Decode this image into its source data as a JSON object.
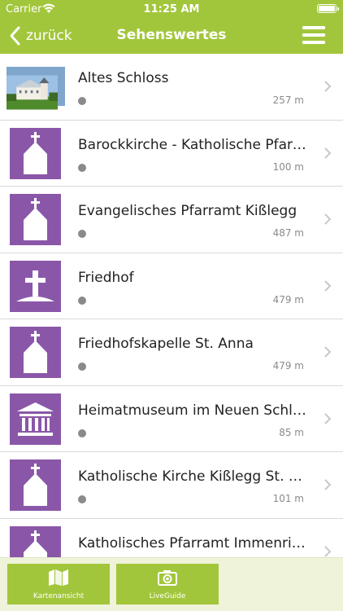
{
  "status": {
    "carrier": "Carrier",
    "time": "11:25 AM"
  },
  "nav": {
    "back_label": "zurück",
    "title": "Sehenswertes"
  },
  "items": [
    {
      "title": "Altes Schloss",
      "distance": "257 m",
      "icon": "castle-photo"
    },
    {
      "title": "Barockkirche - Katholische Pfarrkirche",
      "distance": "100 m",
      "icon": "church-icon"
    },
    {
      "title": "Evangelisches Pfarramt Kißlegg",
      "distance": "487 m",
      "icon": "church-icon"
    },
    {
      "title": "Friedhof",
      "distance": "479 m",
      "icon": "cemetery-icon"
    },
    {
      "title": "Friedhofskapelle St. Anna",
      "distance": "479 m",
      "icon": "church-icon"
    },
    {
      "title": "Heimatmuseum im Neuen Schloss",
      "distance": "85 m",
      "icon": "museum-icon"
    },
    {
      "title": "Katholische Kirche Kißlegg St. Gallus",
      "distance": "101 m",
      "icon": "church-icon"
    },
    {
      "title": "Katholisches Pfarramt Immenried",
      "distance": "",
      "icon": "church-icon"
    }
  ],
  "tabs": [
    {
      "label": "Kartenansicht",
      "icon": "map-icon"
    },
    {
      "label": "LiveGuide",
      "icon": "camera-icon"
    }
  ],
  "colors": {
    "accent": "#a2c63b",
    "icon_bg": "#8a57a8",
    "tabbar_bg": "#eef3d9"
  }
}
